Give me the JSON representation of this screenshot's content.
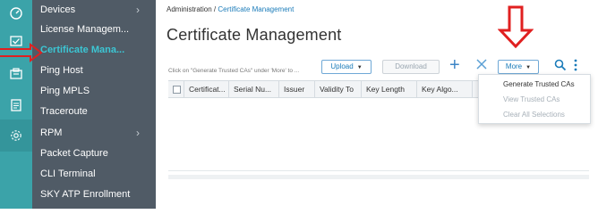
{
  "sidebar": {
    "items": [
      {
        "label": "Devices",
        "has_submenu": true
      },
      {
        "label": "License Managem...",
        "has_submenu": false
      },
      {
        "label": "Certificate Mana...",
        "has_submenu": false,
        "active": true
      },
      {
        "label": "Ping Host",
        "has_submenu": false
      },
      {
        "label": "Ping MPLS",
        "has_submenu": false
      },
      {
        "label": "Traceroute",
        "has_submenu": false
      },
      {
        "label": "RPM",
        "has_submenu": true
      },
      {
        "label": "Packet Capture",
        "has_submenu": false
      },
      {
        "label": "CLI Terminal",
        "has_submenu": false
      },
      {
        "label": "SKY ATP Enrollment",
        "has_submenu": false
      }
    ],
    "chevron": "›"
  },
  "rail_icons": [
    "dashboard-icon",
    "monitor-icon",
    "devices-icon",
    "reports-icon",
    "administration-gear-icon"
  ],
  "breadcrumb": {
    "root": "Administration",
    "separator": "/",
    "current": "Certificate Management"
  },
  "page": {
    "title": "Certificate Management"
  },
  "toolbar": {
    "hint": "Click on \"Generate Trusted CAs\" under 'More' to ...",
    "upload_label": "Upload",
    "download_label": "Download",
    "more_label": "More",
    "add_glyph": "+"
  },
  "table": {
    "columns": [
      "Certificat...",
      "Serial Nu...",
      "Issuer",
      "Validity To",
      "Key Length",
      "Key Algo..."
    ]
  },
  "more_menu": {
    "items": [
      {
        "label": "Generate Trusted CAs",
        "enabled": true
      },
      {
        "label": "View Trusted CAs",
        "enabled": false
      },
      {
        "label": "Clear All Selections",
        "enabled": false
      }
    ]
  },
  "colors": {
    "rail": "#3ba3a9",
    "sidebar": "#505b66",
    "active_item": "#3cc6d4",
    "link": "#1a7bb9",
    "annotation_arrow": "#e02020"
  }
}
